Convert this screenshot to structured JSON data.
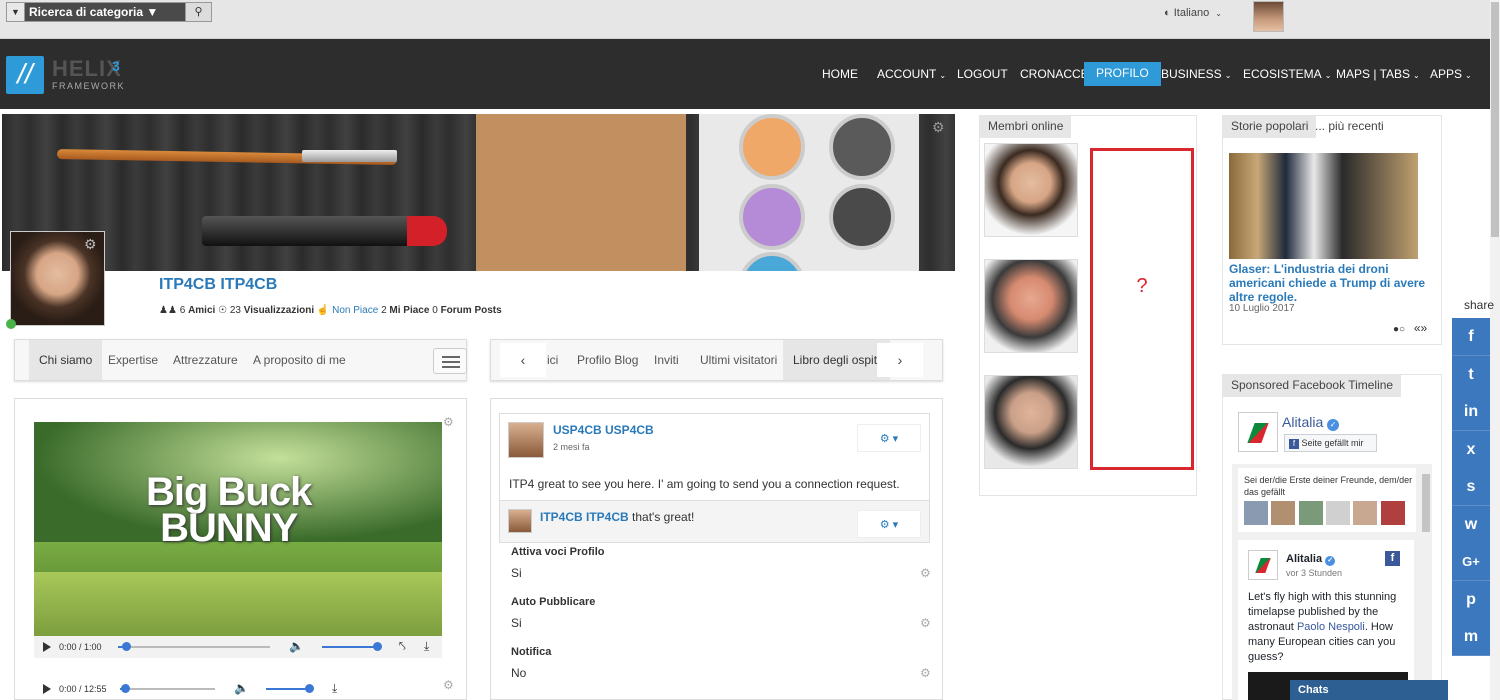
{
  "topbar": {
    "category_search": "Ricerca di categoria ▼",
    "language": "Italiano",
    "dropdown_icon": "chevron-down-icon",
    "search_icon": "search-icon",
    "globe_icon": "globe-icon"
  },
  "logo": {
    "brand": "HELIX",
    "version": "3",
    "sub": "FRAMEWORK"
  },
  "nav": {
    "items": [
      {
        "label": "HOME"
      },
      {
        "label": "ACCOUNT"
      },
      {
        "label": "LOGOUT"
      },
      {
        "label": "CRONACCE"
      },
      {
        "label": "PROFILO",
        "active": true
      },
      {
        "label": "BUSINESS"
      },
      {
        "label": "ECOSISTEMA"
      },
      {
        "label": "MAPS | TABS"
      },
      {
        "label": "APPS"
      }
    ],
    "active_color": "#2e9ad8"
  },
  "profile": {
    "name": "ITP4CB ITP4CB",
    "friends_count": "6",
    "friends_label": "Amici",
    "views_count": "23",
    "views_label": "Visualizzazioni",
    "dislike_label": "Non Piace",
    "likes_count": "2",
    "likes_label": "Mi Piace",
    "forum_count": "0",
    "forum_label": "Forum Posts"
  },
  "left_tabs": [
    "Chi siamo",
    "Expertise",
    "Attrezzature",
    "A proposito di me"
  ],
  "right_tabs": [
    "ici",
    "Profilo Blog",
    "Inviti",
    "Ultimi visitatori",
    "Libro degli ospiti"
  ],
  "video": {
    "title_line1": "Big Buck",
    "title_line2": "BUNNY",
    "time1": "0:00 / 1:00",
    "time2": "0:00 / 12:55",
    "progress1": 0.05,
    "progress2": 0.05,
    "volume": 1.0
  },
  "wall": {
    "post_author": "USP4CB USP4CB",
    "post_time": "2 mesi fa",
    "post_text": "ITP4 great to see you here. I' am going to send you a connection request.",
    "reply_author": "ITP4CB ITP4CB",
    "reply_text": "that's great!"
  },
  "settings": [
    {
      "label": "Attiva voci Profilo",
      "value": "Si"
    },
    {
      "label": "Auto Pubblicare",
      "value": "Si"
    },
    {
      "label": "Notifica",
      "value": "No"
    }
  ],
  "membri": {
    "title": "Membri online",
    "question": "?"
  },
  "storie": {
    "tab1": "Storie popolari",
    "tab2": "... più recenti",
    "headline": "Glaser: L'industria dei droni americani chiede a Trump di avere altre regole.",
    "date": "10 Luglio 2017",
    "pager": "«»"
  },
  "sponsored": {
    "title": "Sponsored Facebook Timeline",
    "page_name": "Alitalia",
    "like_btn": "Seite gefällt mir",
    "friends_text": "Sei der/die Erste deiner Freunde, dem/der das gefällt",
    "post_page": "Alitalia",
    "post_time": "vor 3 Stunden",
    "post_text_a": "Let's fly high with this stunning timelapse published by the astronaut",
    "post_link": "Paolo Nespoli",
    "post_text_b": ". How many European cities can you guess?"
  },
  "chat": {
    "label": "Chats"
  },
  "share": {
    "label": "share",
    "buttons": [
      "f",
      "t",
      "in",
      "x",
      "s",
      "w",
      "G+",
      "p",
      "m"
    ]
  },
  "colors": {
    "link": "#2a7ab9",
    "share_bg": "#3b78bd",
    "nav_bg": "#2d2d2d",
    "alert_red": "#d8272f"
  }
}
